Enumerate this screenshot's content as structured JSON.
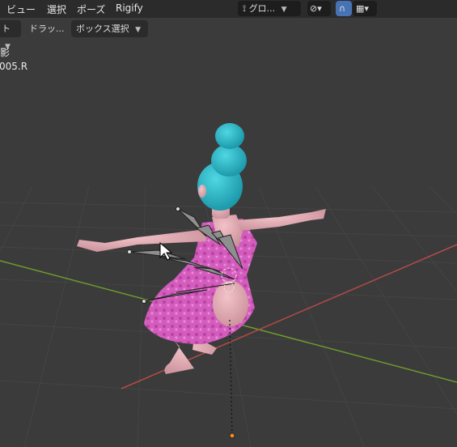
{
  "header": {
    "menu": [
      {
        "label": "ビュー"
      },
      {
        "label": "選択"
      },
      {
        "label": "ポーズ"
      },
      {
        "label": "Rigify"
      }
    ],
    "transform_orientation": "グロ...",
    "pivot_chevron": "▾",
    "snap_chevron": "▾"
  },
  "toolbar": {
    "mode_fragment": "ト",
    "drag_label": "ドラッ...",
    "select_box_label": "ボックス選択"
  },
  "overlay": {
    "view_name": "影",
    "object_name": "005.R"
  },
  "colors": {
    "header_bg": "#2b2b2b",
    "viewport_bg": "#3b3b3b",
    "x_axis": "#b34a4a",
    "y_axis": "#6f9a2e",
    "hair": "#2fb8c6",
    "skin": "#e4aeb6",
    "dress": "#d35cbd",
    "accent": "#4772b3"
  },
  "icons": [
    "transform-orientation-icon",
    "pivot-link-icon",
    "snap-magnet-icon",
    "snap-grid-icon",
    "cursor-arrow-icon"
  ]
}
